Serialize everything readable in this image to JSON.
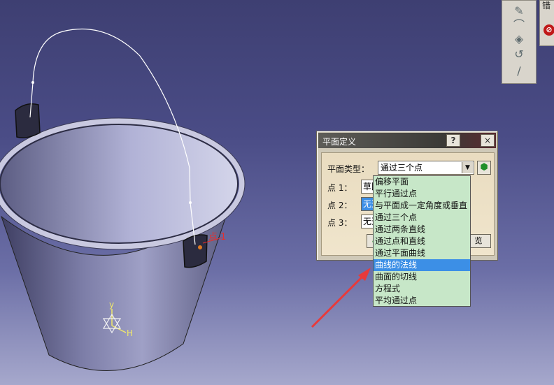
{
  "viewport": {
    "point_label": "点 1",
    "axis_y_label": "y",
    "axis_h_label": "H",
    "colors": {
      "bucket": "#6a6b99",
      "handle": "#ffffff",
      "annotation": "#e23030",
      "axis": "#f1e86a"
    }
  },
  "toolbar": {
    "icons": [
      "sketch-icon",
      "curve-icon",
      "plane-icon",
      "point-icon",
      "spline-icon"
    ],
    "mini_panel_title": "错",
    "mini_panel_icon": "error-icon"
  },
  "dialog": {
    "title": "平面定义",
    "help_label": "?",
    "close_label": "×",
    "plane_type_label": "平面类型：",
    "plane_type_value": "通过三个点",
    "point1_label": "点 1：",
    "point1_value": "草图",
    "point2_label": "点 2：",
    "point2_value": "无选择",
    "point3_label": "点 3：",
    "point3_value": "无选择",
    "preview_label": "览"
  },
  "dropdown": {
    "items": [
      "偏移平面",
      "平行通过点",
      "与平面成一定角度或垂直",
      "通过三个点",
      "通过两条直线",
      "通过点和直线",
      "通过平面曲线",
      "曲线的法线",
      "曲面的切线",
      "方程式",
      "平均通过点"
    ],
    "selected_index": 7
  }
}
